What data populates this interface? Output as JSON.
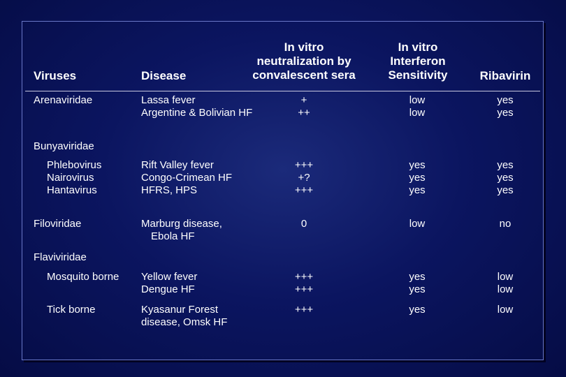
{
  "headers": {
    "viruses": "Viruses",
    "disease": "Disease",
    "neutralization": [
      "In vitro",
      "neutralization by",
      "convalescent sera"
    ],
    "interferon": [
      "In vitro",
      "Interferon",
      "Sensitivity"
    ],
    "ribavirin": "Ribavirin"
  },
  "rows": {
    "arenaviridae": {
      "virus": "Arenaviridae",
      "disease": [
        "Lassa fever",
        "Argentine & Bolivian HF"
      ],
      "neut": [
        "+",
        "++"
      ],
      "ifn": [
        "low",
        "low"
      ],
      "riba": [
        "yes",
        "yes"
      ]
    },
    "bunyaviridae": {
      "family": "Bunyaviridae",
      "virus": [
        "Phlebovirus",
        "Nairovirus",
        "Hantavirus"
      ],
      "disease": [
        "Rift Valley fever",
        "Congo-Crimean HF",
        "HFRS, HPS"
      ],
      "neut": [
        "+++",
        "+?",
        "+++"
      ],
      "ifn": [
        "yes",
        "yes",
        "yes"
      ],
      "riba": [
        "yes",
        "yes",
        "yes"
      ]
    },
    "filoviridae": {
      "virus": "Filoviridae",
      "disease": [
        "Marburg disease,",
        "Ebola HF"
      ],
      "neut": "0",
      "ifn": "low",
      "riba": "no"
    },
    "flaviviridae": {
      "family": "Flaviviridae",
      "mosquito": {
        "virus": "Mosquito borne",
        "disease": [
          "Yellow fever",
          "Dengue HF"
        ],
        "neut": [
          "+++",
          "+++"
        ],
        "ifn": [
          "yes",
          "yes"
        ],
        "riba": [
          "low",
          "low"
        ]
      },
      "tick": {
        "virus": "Tick borne",
        "disease": [
          "Kyasanur Forest",
          "disease, Omsk HF"
        ],
        "neut": "+++",
        "ifn": "yes",
        "riba": "low"
      }
    }
  }
}
